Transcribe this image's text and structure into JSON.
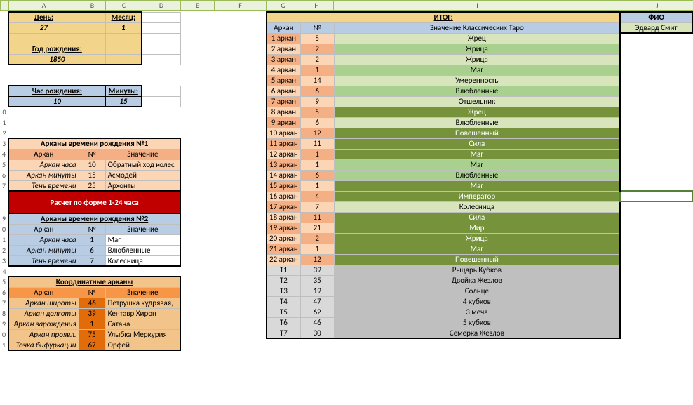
{
  "cols": [
    "A",
    "B",
    "C",
    "D",
    "E",
    "F",
    "G",
    "H",
    "I",
    "J"
  ],
  "topInputs": {
    "dayLabel": "День:",
    "dayVal": "27",
    "monthLabel": "Месяц:",
    "monthVal": "1",
    "yearLabel": "Год рождения:",
    "yearVal": "1850",
    "hourLabel": "Час рождения:",
    "hourVal": "10",
    "minLabel": "Минуты:",
    "minVal": "15"
  },
  "birthTime1": {
    "title": "Арканы времени рождения №1",
    "headers": [
      "Аркан",
      "№",
      "Значение"
    ],
    "rows": [
      [
        "Аркан часа",
        "10",
        "Обратный ход колес"
      ],
      [
        "Аркан минуты",
        "15",
        "Асмодей"
      ],
      [
        "Тень времени",
        "25",
        "Архонты"
      ]
    ]
  },
  "redBar": "Расчет по форме 1-24 часа",
  "birthTime2": {
    "title": "Арканы времени рождения №2",
    "headers": [
      "Аркан",
      "№",
      "Значение"
    ],
    "rows": [
      [
        "Аркан часа",
        "1",
        "Маг"
      ],
      [
        "Аркан минуты",
        "6",
        "Влюбленные"
      ],
      [
        "Тень времени",
        "7",
        "Колесница"
      ]
    ]
  },
  "coord": {
    "title": "Координатные арканы",
    "headers": [
      "Аркан",
      "№",
      "Значение"
    ],
    "rows": [
      [
        "Аркан широты",
        "46",
        "Петрушка кудрявая,"
      ],
      [
        "Аркан долготы",
        "39",
        "Кентавр Хирон"
      ],
      [
        "Аркан зарождения",
        "1",
        "Сатана"
      ],
      [
        "Аркан проявл.",
        "75",
        "Улыбка Меркурия"
      ],
      [
        "Точка бифуркации",
        "67",
        "Орфей"
      ]
    ]
  },
  "main": {
    "title": "ИТОГ:",
    "headers": [
      "Аркан",
      "№",
      "Значение Классических Таро"
    ],
    "fioLabel": "ФИО",
    "fioValue": "Эдвард Смит"
  },
  "arcanes": [
    {
      "label": "1 аркан",
      "num": "5",
      "meaning": "Жрец",
      "g": 0
    },
    {
      "label": "2 аркан",
      "num": "2",
      "meaning": "Жрица",
      "g": 1
    },
    {
      "label": "3 аркан",
      "num": "2",
      "meaning": "Жрица",
      "g": 0
    },
    {
      "label": "4 аркан",
      "num": "1",
      "meaning": "Маг",
      "g": 1
    },
    {
      "label": "5 аркан",
      "num": "14",
      "meaning": "Умеренность",
      "g": 0
    },
    {
      "label": "6 аркан",
      "num": "6",
      "meaning": "Влюбленные",
      "g": 1
    },
    {
      "label": "7 аркан",
      "num": "9",
      "meaning": "Отшельник",
      "g": 0
    },
    {
      "label": "8 аркан",
      "num": "5",
      "meaning": "Жрец",
      "g": 2
    },
    {
      "label": "9 аркан",
      "num": "6",
      "meaning": "Влюбленные",
      "g": 0
    },
    {
      "label": "10 аркан",
      "num": "12",
      "meaning": "Повешенный",
      "g": 2
    },
    {
      "label": "11 аркан",
      "num": "11",
      "meaning": "Сила",
      "g": 2
    },
    {
      "label": "12 аркан",
      "num": "1",
      "meaning": "Маг",
      "g": 2
    },
    {
      "label": "13 аркан",
      "num": "1",
      "meaning": "Маг",
      "g": 1
    },
    {
      "label": "14 аркан",
      "num": "6",
      "meaning": "Влюбленные",
      "g": 1
    },
    {
      "label": "15 аркан",
      "num": "1",
      "meaning": "Маг",
      "g": 2
    },
    {
      "label": "16 аркан",
      "num": "4",
      "meaning": "Император",
      "g": 2
    },
    {
      "label": "17 аркан",
      "num": "7",
      "meaning": "Колесница",
      "g": 0
    },
    {
      "label": "18 аркан",
      "num": "11",
      "meaning": "Сила",
      "g": 2
    },
    {
      "label": "19 аркан",
      "num": "21",
      "meaning": "Мир",
      "g": 2
    },
    {
      "label": "20 аркан",
      "num": "2",
      "meaning": "Жрица",
      "g": 2
    },
    {
      "label": "21 аркан",
      "num": "1",
      "meaning": "Маг",
      "g": 2
    },
    {
      "label": "22 аркан",
      "num": "12",
      "meaning": "Повешенный",
      "g": 2
    }
  ],
  "trows": [
    {
      "label": "Т1",
      "num": "39",
      "meaning": "Рыцарь Кубков"
    },
    {
      "label": "Т2",
      "num": "35",
      "meaning": "Двойка Жезлов"
    },
    {
      "label": "Т3",
      "num": "19",
      "meaning": "Солнце"
    },
    {
      "label": "Т4",
      "num": "47",
      "meaning": "4 кубков"
    },
    {
      "label": "Т5",
      "num": "62",
      "meaning": "3 меча"
    },
    {
      "label": "Т6",
      "num": "46",
      "meaning": "5 кубков"
    },
    {
      "label": "Т7",
      "num": "30",
      "meaning": "Семерка Жезлов"
    }
  ],
  "chart_data": {
    "type": "table",
    "title": "ИТОГ: Значение Классических Таро",
    "categories": [
      "1 аркан",
      "2 аркан",
      "3 аркан",
      "4 аркан",
      "5 аркан",
      "6 аркан",
      "7 аркан",
      "8 аркан",
      "9 аркан",
      "10 аркан",
      "11 аркан",
      "12 аркан",
      "13 аркан",
      "14 аркан",
      "15 аркан",
      "16 аркан",
      "17 аркан",
      "18 аркан",
      "19 аркан",
      "20 аркан",
      "21 аркан",
      "22 аркан",
      "Т1",
      "Т2",
      "Т3",
      "Т4",
      "Т5",
      "Т6",
      "Т7"
    ],
    "values": [
      5,
      2,
      2,
      1,
      14,
      6,
      9,
      5,
      6,
      12,
      11,
      1,
      1,
      6,
      1,
      4,
      7,
      11,
      21,
      2,
      1,
      12,
      39,
      35,
      19,
      47,
      62,
      46,
      30
    ]
  }
}
